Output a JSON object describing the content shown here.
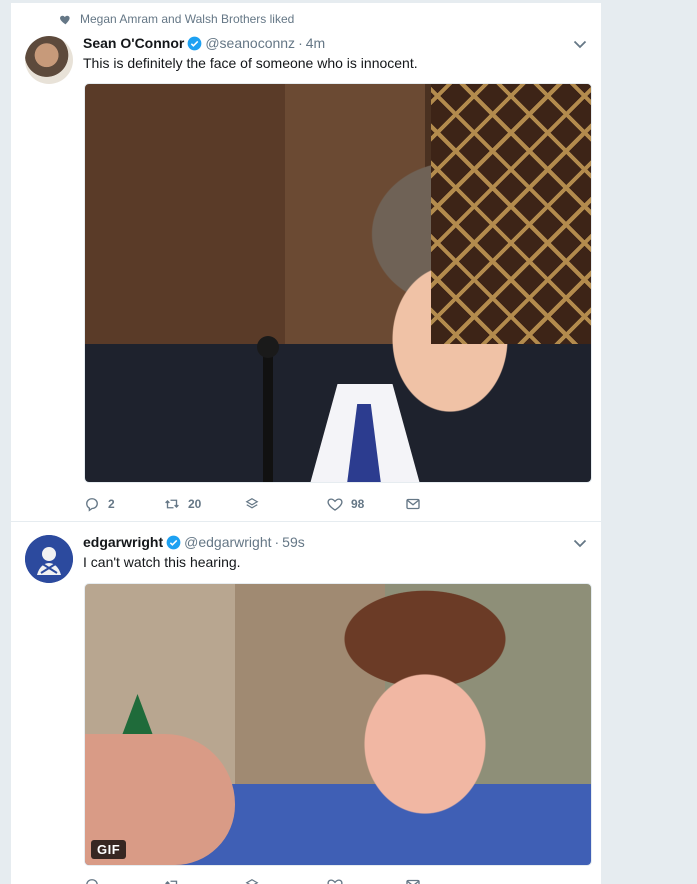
{
  "tweets": [
    {
      "social_context": "Megan Amram and Walsh Brothers liked",
      "fullname": "Sean O'Connor",
      "handle": "@seanoconnz",
      "time": "4m",
      "text": "This is definitely the face of someone who is innocent.",
      "actions": {
        "replies": "2",
        "retweets": "20",
        "likes": "98"
      }
    },
    {
      "fullname": "edgarwright",
      "handle": "@edgarwright",
      "time": "59s",
      "text": "I can't watch this hearing.",
      "media_badge": "GIF"
    }
  ],
  "separator": "·",
  "colors": {
    "accent": "#1da1f2",
    "muted": "#657786",
    "background": "#e6ecf0"
  }
}
